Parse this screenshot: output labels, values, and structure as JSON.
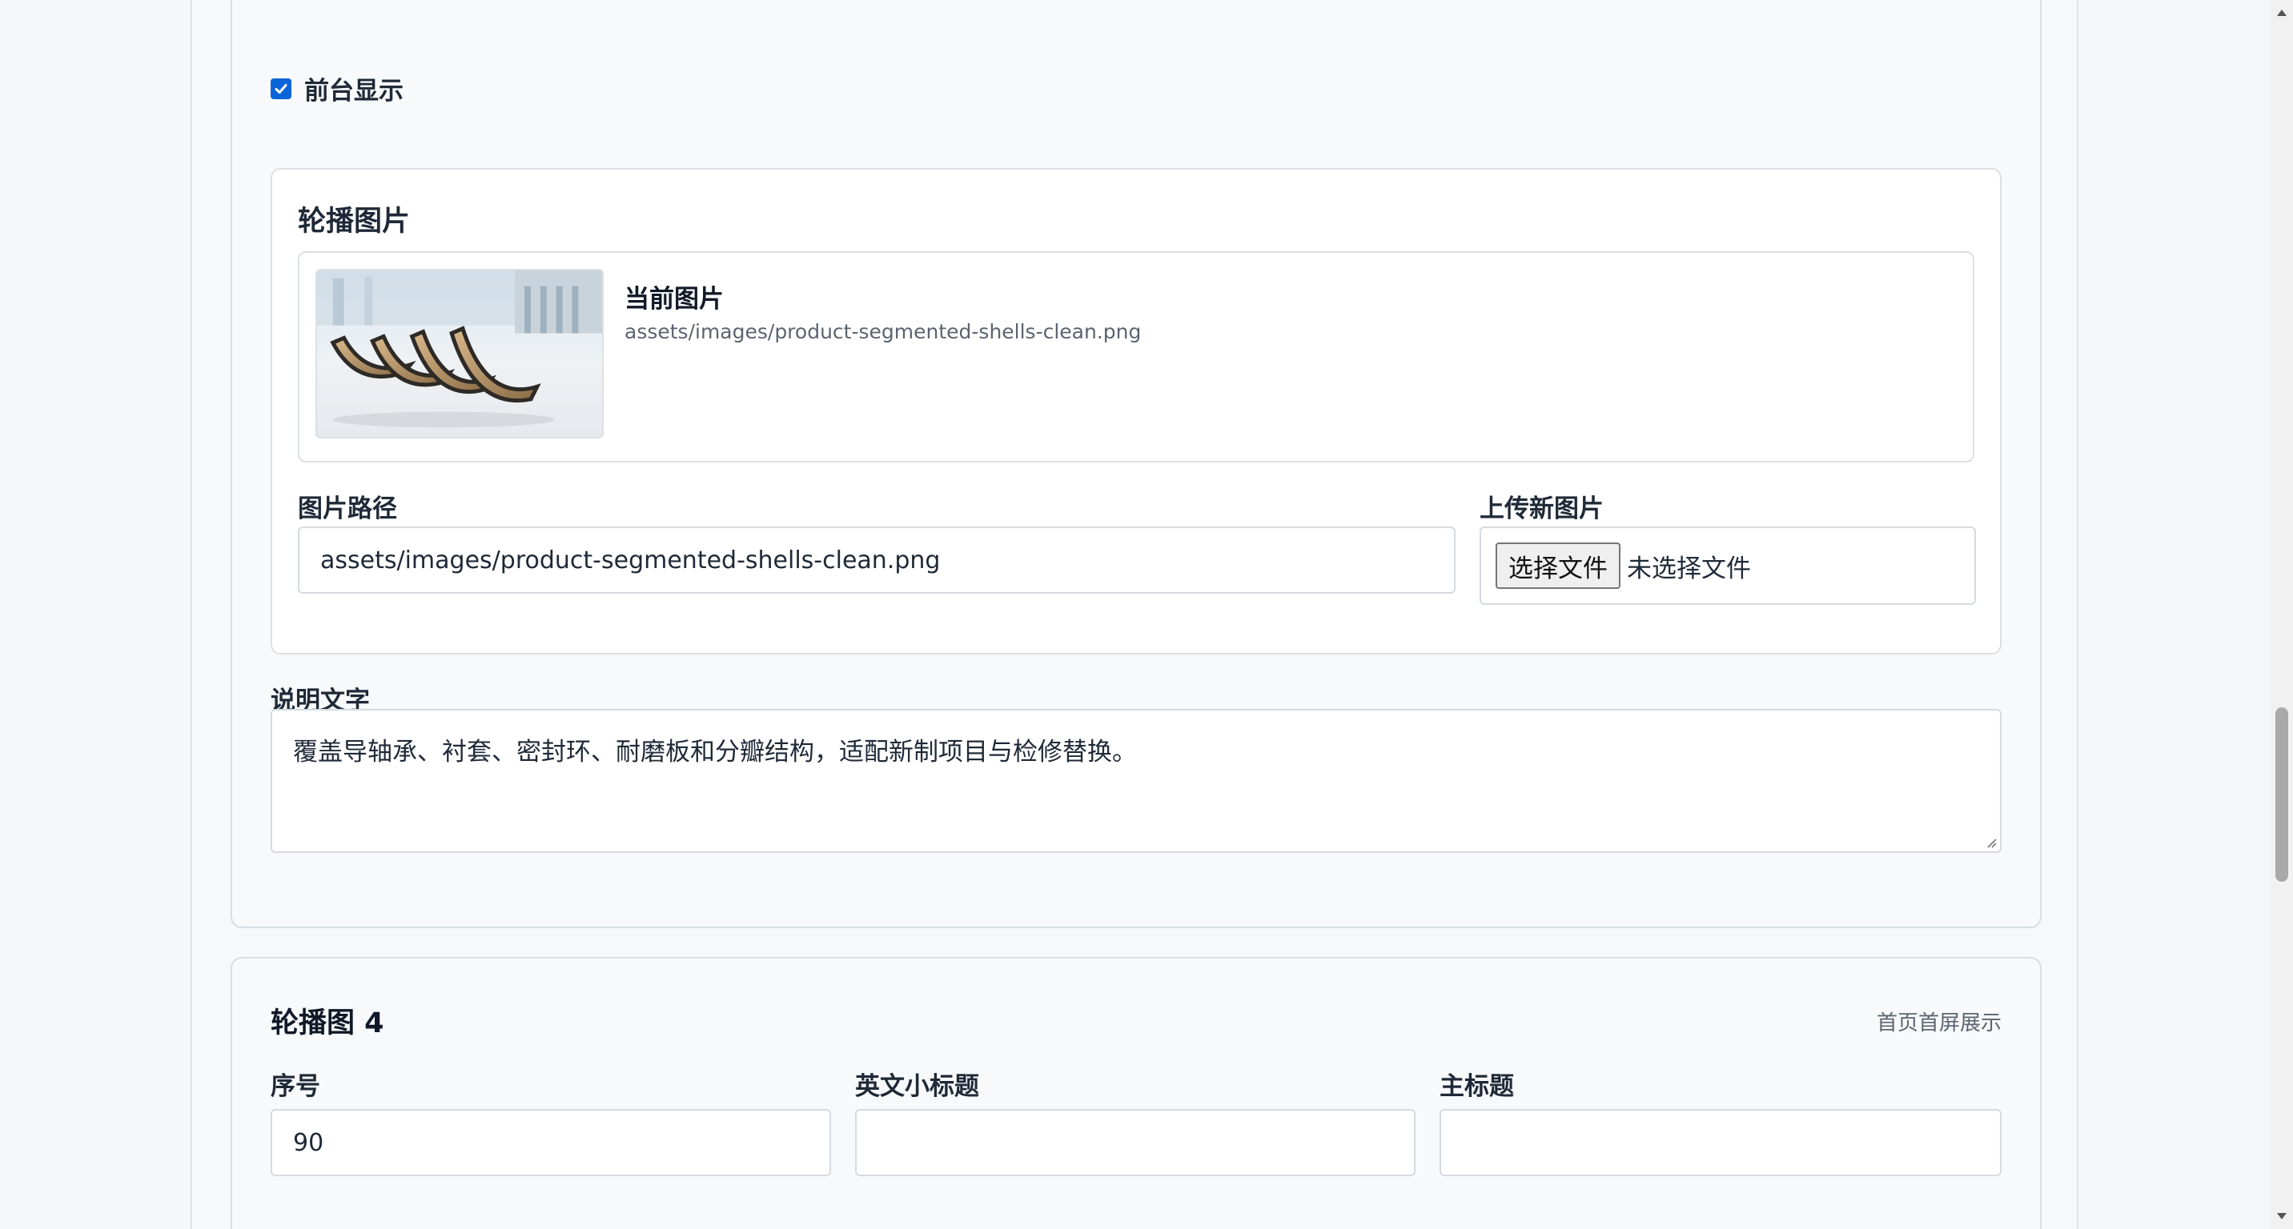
{
  "frontend_display": {
    "label": "前台显示",
    "checked": true
  },
  "carousel_image": {
    "section_title": "轮播图片",
    "current_image_title": "当前图片",
    "current_image_path": "assets/images/product-segmented-shells-clean.png",
    "image_path_label": "图片路径",
    "image_path_value": "assets/images/product-segmented-shells-clean.png",
    "upload_label": "上传新图片",
    "choose_file_button": "选择文件",
    "no_file_text": "未选择文件"
  },
  "caption": {
    "label": "说明文字",
    "value": "覆盖导轴承、衬套、密封环、耐磨板和分瓣结构，适配新制项目与检修替换。"
  },
  "carousel_4": {
    "heading": "轮播图 4",
    "note": "首页首屏展示",
    "order_label": "序号",
    "order_value": "90",
    "en_subtitle_label": "英文小标题",
    "en_subtitle_value": "",
    "main_title_label": "主标题",
    "main_title_value": ""
  },
  "colors": {
    "accent": "#0a66d8",
    "page_bg": "#f5f7f8",
    "card_border": "#d9dee3",
    "muted_text": "#5b6470"
  }
}
